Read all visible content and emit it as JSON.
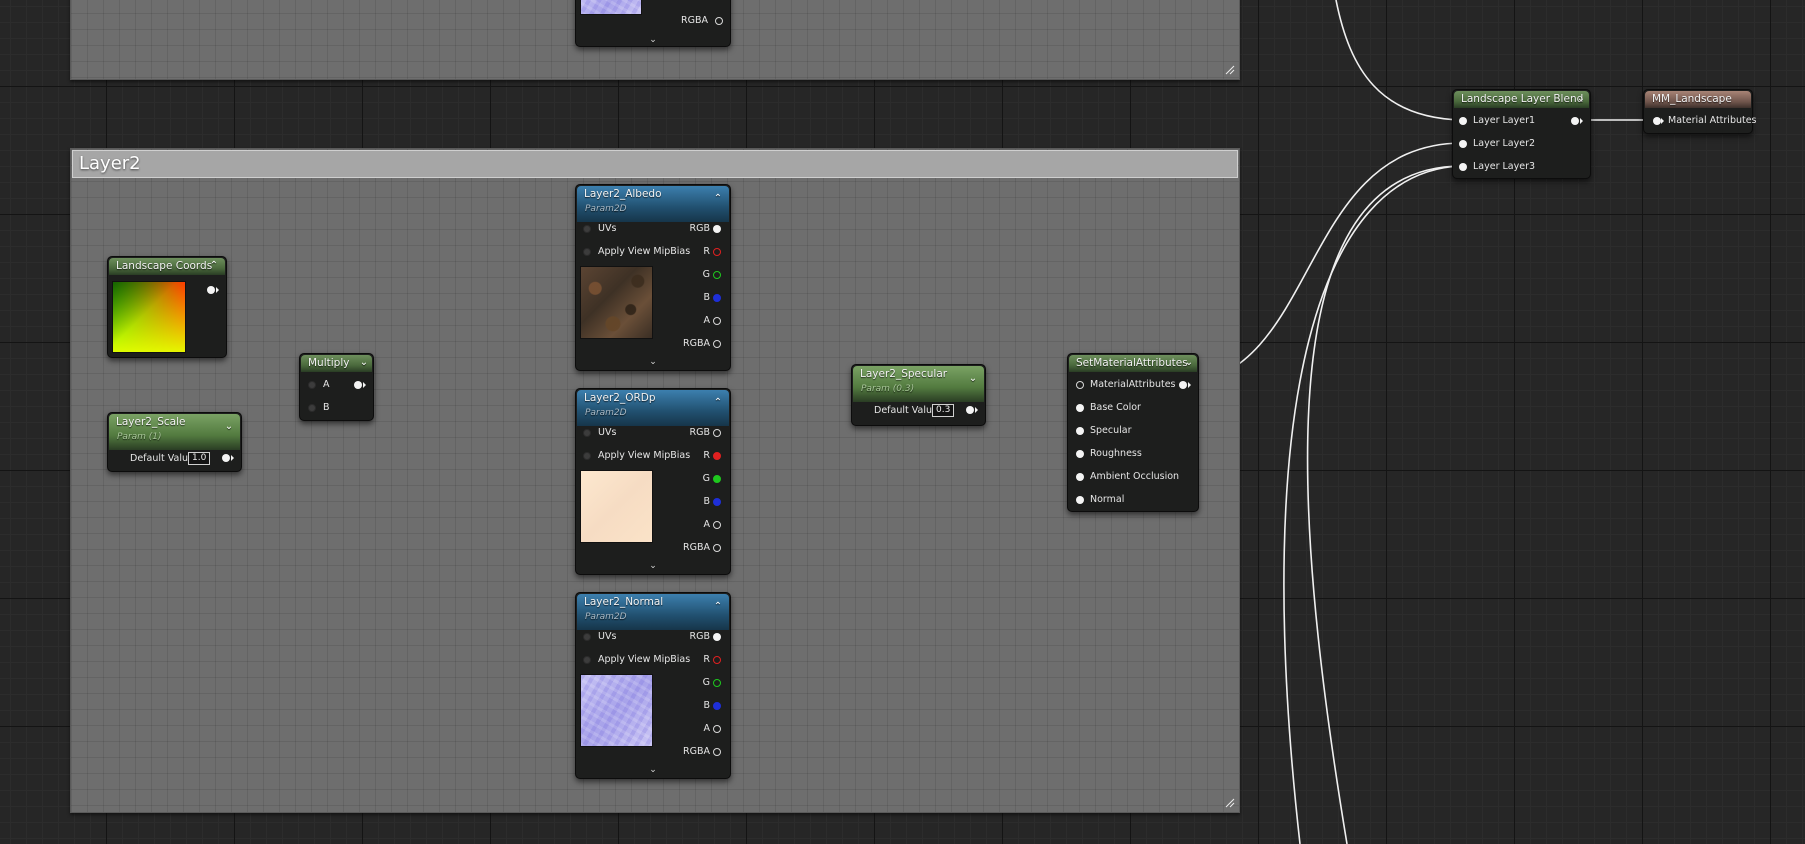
{
  "comments": {
    "top": {
      "title": ""
    },
    "layer2": {
      "title": "Layer2"
    }
  },
  "nodes": {
    "top_partial": {
      "pin_rgba": "RGBA"
    },
    "landscape_coords": {
      "title": "Landscape Coords"
    },
    "layer2_scale": {
      "title": "Layer2_Scale",
      "subtitle": "Param (1)",
      "default_label": "Default Value",
      "default_value": "1.0"
    },
    "multiply": {
      "title": "Multiply",
      "pin_a": "A",
      "pin_b": "B"
    },
    "layer2_albedo": {
      "title": "Layer2_Albedo",
      "subtitle": "Param2D",
      "uvs": "UVs",
      "mipbias": "Apply View MipBias",
      "rgb": "RGB",
      "r": "R",
      "g": "G",
      "b": "B",
      "a": "A",
      "rgba": "RGBA"
    },
    "layer2_ordp": {
      "title": "Layer2_ORDp",
      "subtitle": "Param2D",
      "uvs": "UVs",
      "mipbias": "Apply View MipBias",
      "rgb": "RGB",
      "r": "R",
      "g": "G",
      "b": "B",
      "a": "A",
      "rgba": "RGBA"
    },
    "layer2_normal": {
      "title": "Layer2_Normal",
      "subtitle": "Param2D",
      "uvs": "UVs",
      "mipbias": "Apply View MipBias",
      "rgb": "RGB",
      "r": "R",
      "g": "G",
      "b": "B",
      "a": "A",
      "rgba": "RGBA"
    },
    "layer2_specular": {
      "title": "Layer2_Specular",
      "subtitle": "Param (0.3)",
      "default_label": "Default Value",
      "default_value": "0.3"
    },
    "set_material_attributes": {
      "title": "SetMaterialAttributes",
      "pins": [
        "MaterialAttributes",
        "Base Color",
        "Specular",
        "Roughness",
        "Ambient Occlusion",
        "Normal"
      ]
    },
    "landscape_layer_blend": {
      "title": "Landscape Layer Blend",
      "pins": [
        "Layer Layer1",
        "Layer Layer2",
        "Layer Layer3"
      ]
    },
    "mm_landscape": {
      "title": "MM_Landscape",
      "pin": "Material Attributes"
    }
  },
  "colors": {
    "wire": "#ffffff",
    "channel_r": "#e02020",
    "channel_g": "#1ec81e",
    "channel_b": "#1e2fd8",
    "param_header": "#6d9a58",
    "texture_header": "#2f6d96",
    "result_header": "#8c6c60"
  }
}
